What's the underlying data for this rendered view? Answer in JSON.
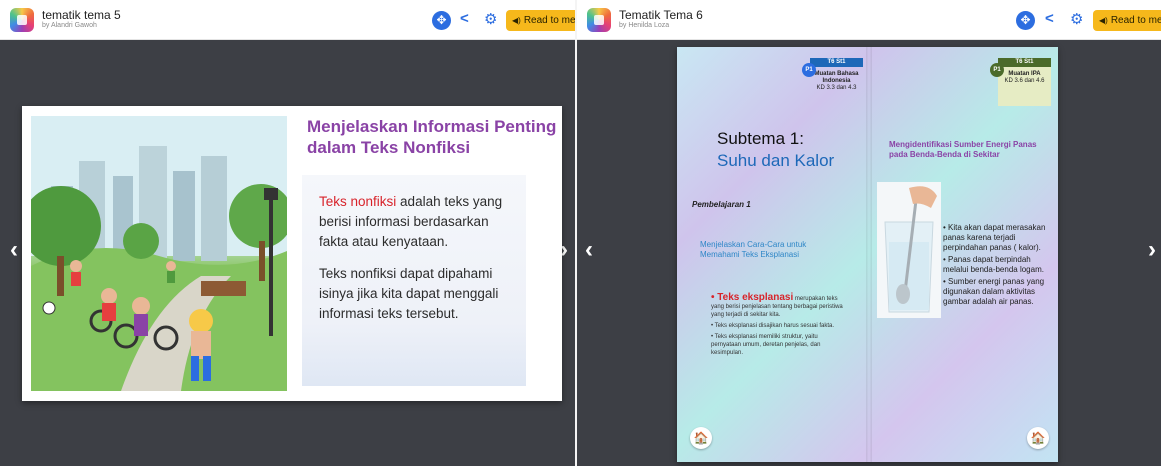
{
  "left": {
    "app": {
      "title": "tematik tema 5",
      "author": "by Alandri Gawoh"
    },
    "toolbar": {
      "share_icon": "<",
      "settings_icon": "⚙",
      "read_label": "Read to me"
    },
    "page": {
      "heading": "Menjelaskan Informasi Penting dalam Teks Nonfiksi",
      "para1_highlight": "Teks nonfiksi",
      "para1_rest": " adalah teks yang berisi informasi berdasarkan fakta atau kenyataan.",
      "para2": "Teks nonfiksi dapat dipahami isinya jika kita dapat menggali informasi teks tersebut."
    },
    "prev_arrow": "‹",
    "next_arrow": "›"
  },
  "right": {
    "app": {
      "title": "Tematik Tema 6",
      "author": "by Henilda Loza"
    },
    "toolbar": {
      "share_icon": "<",
      "settings_icon": "⚙",
      "read_label": "Read to me"
    },
    "left_page": {
      "tag_band": "T6 St1",
      "tag_p": "P1",
      "tag_subject": "Muatan Bahasa Indonesia",
      "tag_kd": "KD 3.3 dan 4.3",
      "subtema_1": "Subtema 1:",
      "subtema_2": "Suhu dan Kalor",
      "pembelajaran": "Pembelajaran 1",
      "menjelaskan": "Menjelaskan Cara-Cara untuk Memahami Teks Eksplanasi",
      "bullet1_bold": "• Teks eksplanasi",
      "bullet1_rest": " merupakan teks yang berisi penjelasan tentang berbagai peristiwa yang terjadi di sekitar kita.",
      "bullet2": "• Teks eksplanasi disajikan harus sesuai fakta.",
      "bullet3": "• Teks eksplanasi memiliki struktur, yaitu pernyataan umum, deretan penjelas, dan kesimpulan."
    },
    "right_page": {
      "tag_band": "T6 St1",
      "tag_p": "P1",
      "tag_subject": "Muatan IPA",
      "tag_kd": "KD 3.6 dan 4.6",
      "mengidentifikasi": "Mengidentifikasi Sumber Energi Panas pada Benda-Benda di Sekitar",
      "bullet1": "• Kita akan dapat merasakan panas karena terjadi perpindahan panas ( kalor).",
      "bullet2": "• Panas dapat berpindah melalui benda-benda logam.",
      "bullet3": "• Sumber energi panas yang digunakan dalam aktivitas gambar adalah air panas."
    },
    "home_icon": "🏠",
    "prev_arrow": "‹",
    "next_arrow": "›"
  },
  "colors": {
    "accent_blue": "#2c6de0",
    "read_button": "#f6b81b",
    "stage": "#3d3f45",
    "heading_purple": "#8a43a6",
    "highlight_red": "#d8232a"
  }
}
